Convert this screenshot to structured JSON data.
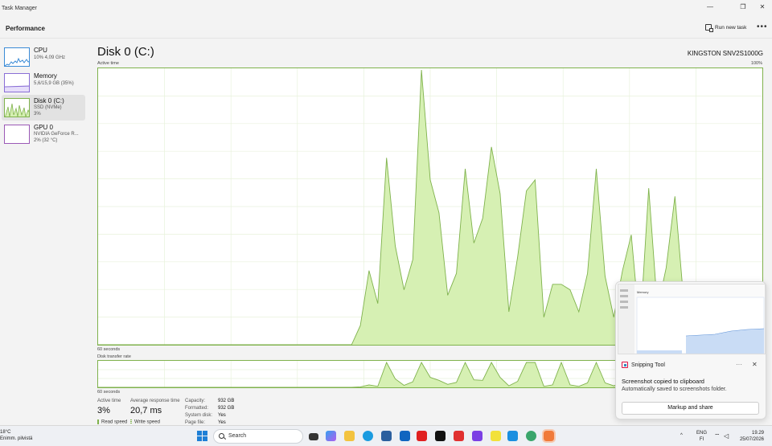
{
  "window": {
    "title": "Task Manager",
    "minimize_glyph": "—",
    "maximize_glyph": "❐",
    "close_glyph": "✕"
  },
  "header": {
    "page_title": "Performance",
    "run_task_label": "Run new task",
    "more_glyph": "•••"
  },
  "sidebar": {
    "items": [
      {
        "name": "CPU",
        "line1": "10%  4,09 GHz",
        "line2": ""
      },
      {
        "name": "Memory",
        "line1": "5,6/15,9 GB (35%)",
        "line2": ""
      },
      {
        "name": "Disk 0 (C:)",
        "line1": "SSD (NVMe)",
        "line2": "3%"
      },
      {
        "name": "GPU 0",
        "line1": "NVIDIA GeForce R...",
        "line2": "2%  (32 °C)"
      }
    ]
  },
  "disk": {
    "title": "Disk 0 (C:)",
    "model": "KINGSTON SNV2S1000G",
    "active_time_label": "Active time",
    "max_label": "100%",
    "seconds_label": "60 seconds",
    "transfer_label": "Disk transfer rate",
    "seconds_label2": "60 seconds"
  },
  "stats": {
    "active_time": {
      "label": "Active time",
      "value": "3%"
    },
    "avg_response": {
      "label": "Average response time",
      "value": "20,7 ms"
    },
    "read_speed_label": "Read speed",
    "write_speed_label": "Write speed",
    "kv": [
      {
        "k": "Capacity:",
        "v": "932 GB"
      },
      {
        "k": "Formatted:",
        "v": "932 GB"
      },
      {
        "k": "System disk:",
        "v": "Yes"
      },
      {
        "k": "Page file:",
        "v": "Yes"
      }
    ]
  },
  "toast": {
    "app": "Snipping Tool",
    "dots": "···",
    "close": "✕",
    "headline": "Screenshot copied to clipboard",
    "body": "Automatically saved to screenshots folder.",
    "button": "Markup and share",
    "preview_heading": "Memory"
  },
  "taskbar": {
    "weather_temp": "18°C",
    "weather_desc": "Enimm. pilvistä",
    "search_placeholder": "Search",
    "lang_top": "ENG",
    "lang_bottom": "FI",
    "time": "19.29",
    "date": "25/07/2026"
  },
  "colors": {
    "disk_accent": "#7fb24c",
    "disk_fill": "#d6f0b3",
    "cpu_accent": "#3b8bd6",
    "memory_accent": "#8a6fd6",
    "gpu_accent": "#9b59b6"
  },
  "chart_data": {
    "type": "area",
    "title": "Disk 0 (C:) Active time",
    "ylim": [
      0,
      100
    ],
    "x_points": 60,
    "series": [
      {
        "name": "Active time",
        "values": [
          0,
          0,
          0,
          0,
          0,
          0,
          0,
          0,
          0,
          0,
          0,
          0,
          0,
          0,
          0,
          0,
          0,
          0,
          0,
          0,
          0,
          0,
          0,
          0,
          0,
          0,
          0,
          0,
          0,
          0,
          7,
          27,
          15,
          68,
          36,
          20,
          31,
          100,
          60,
          48,
          18,
          26,
          64,
          37,
          46,
          72,
          55,
          12,
          32,
          56,
          60,
          10,
          22,
          22,
          20,
          12,
          26,
          64,
          25,
          10,
          27,
          40,
          5,
          57,
          13,
          28,
          54,
          16,
          0,
          0,
          0,
          0,
          0,
          0,
          0,
          0,
          0
        ]
      }
    ],
    "transfer": {
      "name": "Disk transfer rate",
      "values": [
        0,
        0,
        0,
        0,
        0,
        0,
        0,
        0,
        0,
        0,
        0,
        0,
        0,
        0,
        0,
        0,
        0,
        0,
        0,
        0,
        0,
        0,
        0,
        0,
        0,
        0,
        0,
        0,
        0,
        0,
        2,
        10,
        4,
        100,
        34,
        8,
        22,
        100,
        40,
        28,
        12,
        20,
        100,
        30,
        28,
        100,
        40,
        6,
        24,
        100,
        100,
        4,
        10,
        100,
        10,
        4,
        18,
        100,
        18,
        6,
        18,
        30,
        2,
        100,
        8,
        20,
        100,
        10,
        0,
        0,
        0,
        0,
        0,
        0,
        0,
        0,
        0
      ]
    },
    "grid": true
  }
}
